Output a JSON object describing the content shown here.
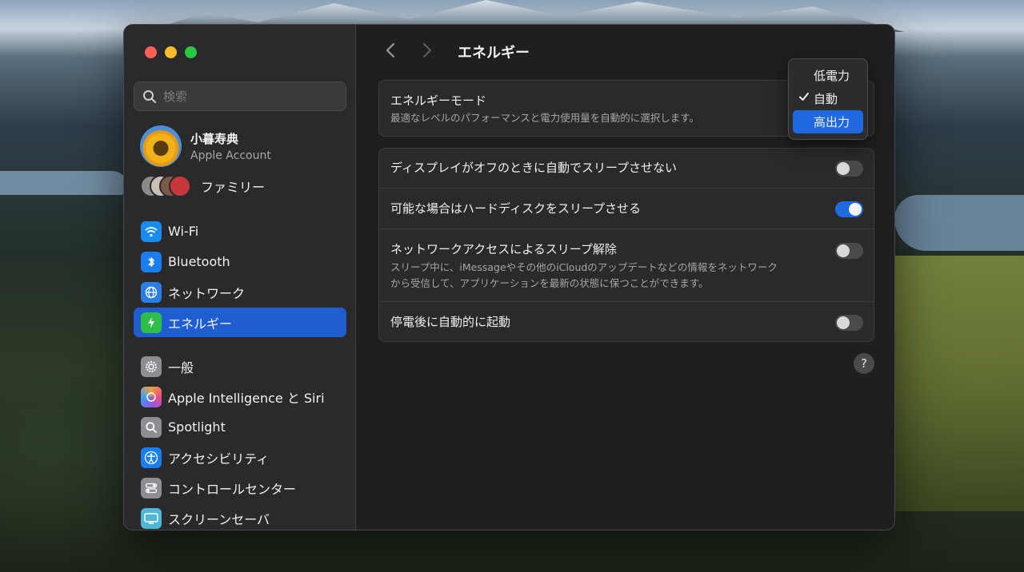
{
  "window": {
    "page_title": "エネルギー"
  },
  "sidebar": {
    "search_placeholder": "検索",
    "account": {
      "name": "小暮寿典",
      "subtitle": "Apple Account"
    },
    "family_label": "ファミリー",
    "items": [
      {
        "key": "wifi",
        "label": "Wi-Fi",
        "icon": "wifi-icon"
      },
      {
        "key": "bluetooth",
        "label": "Bluetooth",
        "icon": "bluetooth-icon"
      },
      {
        "key": "network",
        "label": "ネットワーク",
        "icon": "globe-icon"
      },
      {
        "key": "energy",
        "label": "エネルギー",
        "icon": "lightning-icon",
        "selected": true
      },
      {
        "key": "general",
        "label": "一般",
        "icon": "gear-icon"
      },
      {
        "key": "ai",
        "label": "Apple Intelligence と Siri",
        "icon": "apple-intelligence-icon"
      },
      {
        "key": "spotlight",
        "label": "Spotlight",
        "icon": "magnifier-icon"
      },
      {
        "key": "accessibility",
        "label": "アクセシビリティ",
        "icon": "accessibility-icon"
      },
      {
        "key": "control_center",
        "label": "コントロールセンター",
        "icon": "control-center-icon"
      },
      {
        "key": "screensaver",
        "label": "スクリーンセーバ",
        "icon": "screensaver-icon"
      }
    ]
  },
  "energy_mode": {
    "title": "エネルギーモード",
    "description": "最適なレベルのパフォーマンスと電力使用量を自動的に選択します。",
    "options": [
      {
        "label": "低電力",
        "checked": false,
        "highlighted": false
      },
      {
        "label": "自動",
        "checked": true,
        "highlighted": false
      },
      {
        "label": "高出力",
        "checked": false,
        "highlighted": true
      }
    ]
  },
  "settings": [
    {
      "title": "ディスプレイがオフのときに自動でスリープさせない",
      "on": false
    },
    {
      "title": "可能な場合はハードディスクをスリープさせる",
      "on": true
    },
    {
      "title": "ネットワークアクセスによるスリープ解除",
      "description_line1": "スリープ中に、iMessageやその他のiCloudのアップデートなどの情報をネットワーク",
      "description_line2": "から受信して、アプリケーションを最新の状態に保つことができます。",
      "on": false
    },
    {
      "title": "停電後に自動的に起動",
      "on": false
    }
  ],
  "help_label": "?",
  "colors": {
    "accent": "#1f5ed1",
    "toggle_on": "#1f6ae0"
  }
}
